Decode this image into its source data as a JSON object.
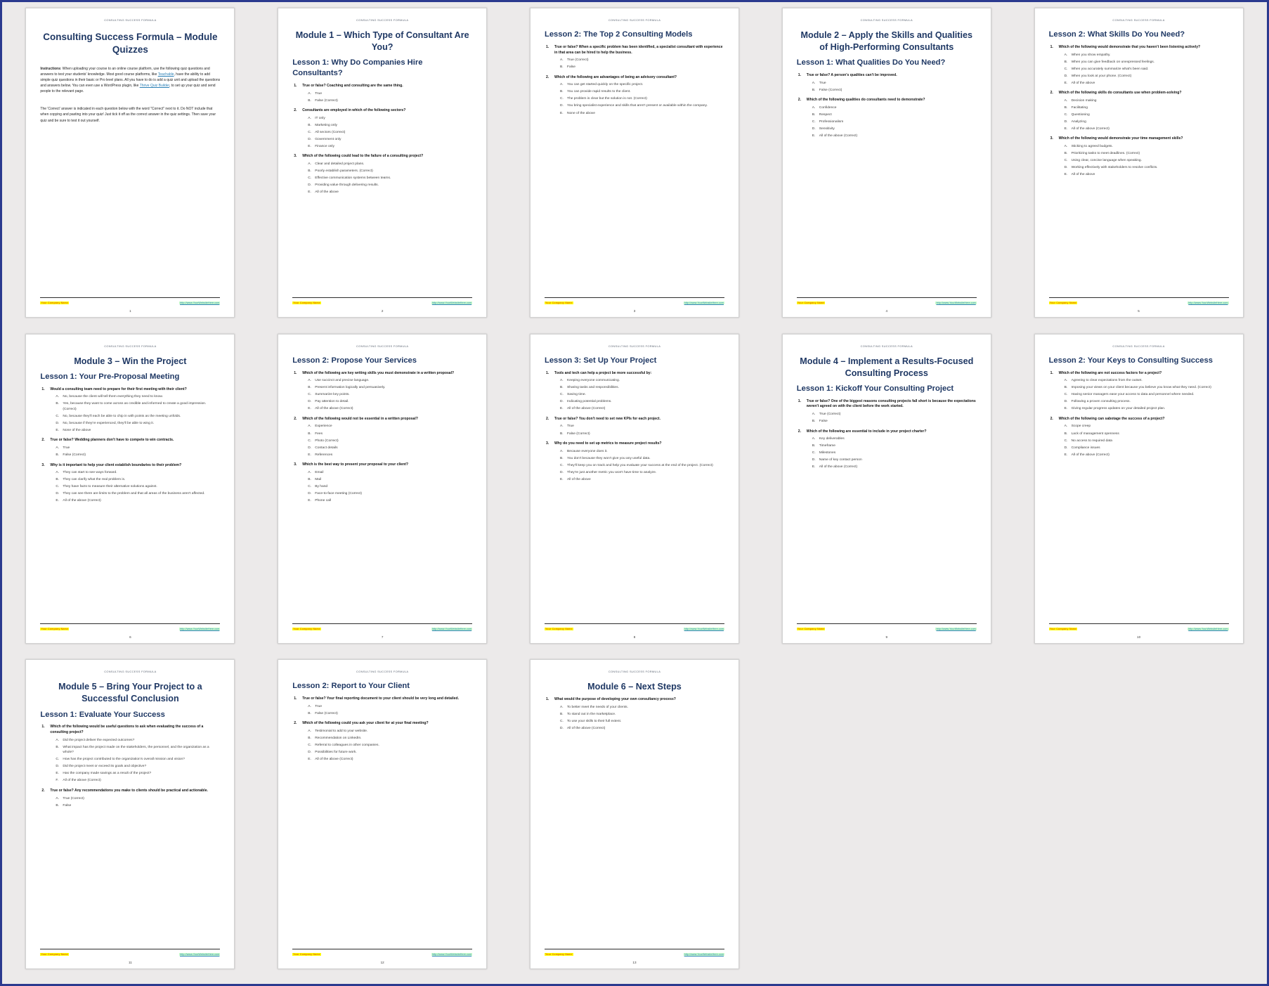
{
  "document": {
    "running_head": "CONSULTING SUCCESS FORMULA",
    "footer": {
      "company": "Your Company Name",
      "url": "http://www.YourWebsiteHere.com"
    }
  },
  "pages": [
    {
      "number": "1",
      "doc_title": "Consulting Success Formula – Module Quizzes",
      "instructions": [
        "When uploading your course to an online course platform, use the following quiz questions and answers to test your students' knowledge. Most good course platforms, like Teachable, have the ability to add simple quiz questions in their basic or Pro level plans. All you have to do is add a quiz unit and upload the questions and answers below. You can even use a WordPress plugin, like Thrive Quiz Builder, to set up your quiz and send people to the relevant page.",
        "The 'Correct' answer is indicated in each question below with the word \"Correct\" next to it. Do NOT include that when copying and pasting into your quiz! Just tick it off as the correct answer in the quiz settings. Then save your quiz and be sure to test it out yourself."
      ],
      "instructions_label": "Instructions",
      "links": [
        "Teachable",
        "Thrive Quiz Builder"
      ]
    },
    {
      "number": "2",
      "module_title": "Module 1 – Which Type of Consultant Are You?",
      "lesson_title": "Lesson 1: Why Do Companies Hire Consultants?",
      "questions": [
        {
          "q": "True or false? Coaching and consulting are the same thing.",
          "a": [
            "True",
            "False (Correct)"
          ]
        },
        {
          "q": "Consultants are employed in which of the following sectors?",
          "a": [
            "IT only",
            "Marketing only",
            "All sectors (Correct)",
            "Government only",
            "Finance only"
          ]
        },
        {
          "q": "Which of the following could lead to the failure of a consulting project?",
          "a": [
            "Clear and detailed project plans.",
            "Poorly establish parameters. (Correct)",
            "Effective communication systems between teams.",
            "Providing value through delivering results.",
            "All of the above"
          ]
        }
      ]
    },
    {
      "number": "3",
      "lesson_title": "Lesson 2: The Top 2 Consulting Models",
      "questions": [
        {
          "q": "True or false? When a specific problem has been identified, a specialist consultant with experience in that area can be hired to help the business.",
          "a": [
            "True (Correct)",
            "False"
          ]
        },
        {
          "q": "Which of the following are advantages of being an advisory consultant?",
          "a": [
            "You can get started quickly on the specific project.",
            "You can provide rapid results to the client.",
            "The problem is clear but the solution is not. (Correct)",
            "You bring specialist experience and skills that aren't present or available within the company.",
            "None of the above"
          ]
        }
      ]
    },
    {
      "number": "4",
      "module_title": "Module 2 – Apply the Skills and Qualities of High-Performing Consultants",
      "lesson_title": "Lesson 1: What Qualities Do You Need?",
      "questions": [
        {
          "q": "True or false? A person's qualities can't be improved.",
          "a": [
            "True",
            "False (Correct)"
          ]
        },
        {
          "q": "Which of the following qualities do consultants need to demonstrate?",
          "a": [
            "Confidence",
            "Respect",
            "Professionalism",
            "Sensitivity",
            "All of the above (Correct)"
          ]
        }
      ]
    },
    {
      "number": "5",
      "lesson_title": "Lesson 2: What Skills Do You Need?",
      "questions": [
        {
          "q": "Which of the following would demonstrate that you haven't been listening actively?",
          "a": [
            "When you show empathy.",
            "When you can give feedback on unexpressed feelings.",
            "When you accurately summarize what's been said.",
            "When you look at your phone. (Correct)",
            "All of the above"
          ]
        },
        {
          "q": "Which of the following skills do consultants use when problem-solving?",
          "a": [
            "Decision making",
            "Facilitating",
            "Questioning",
            "Analyzing",
            "All of the above (Correct)"
          ]
        },
        {
          "q": "Which of the following would demonstrate your time management skills?",
          "a": [
            "Sticking to agreed budgets.",
            "Prioritizing tasks to meet deadlines. (Correct)",
            "Using clear, concise language when speaking.",
            "Working effectively with stakeholders to resolve conflicts.",
            "All of the above"
          ]
        }
      ]
    },
    {
      "number": "6",
      "module_title": "Module 3 – Win the Project",
      "lesson_title": "Lesson 1: Your Pre-Proposal Meeting",
      "questions": [
        {
          "q": "Would a consulting team need to prepare for their first meeting with their client?",
          "a": [
            "No, because the client will tell them everything they need to know.",
            "Yes, because they want to come across as credible and informed to create a good impression. (Correct)",
            "No, because they'll each be able to chip in with points as the meeting unfolds.",
            "No, because if they're experienced, they'll be able to wing it.",
            "None of the above"
          ]
        },
        {
          "q": "True or false? Wedding planners don't have to compete to win contracts.",
          "a": [
            "True",
            "False (Correct)"
          ]
        },
        {
          "q": "Why is it important to help your client establish boundaries to their problem?",
          "a": [
            "They can start to see ways forward.",
            "They can clarify what the real problem is.",
            "They have facts to measure their alternative solutions against.",
            "They can see there are limits to the problem and that all areas of the business aren't affected.",
            "All of the above (Correct)"
          ]
        }
      ]
    },
    {
      "number": "7",
      "lesson_title": "Lesson 2: Propose Your Services",
      "questions": [
        {
          "q": "Which of the following are key writing skills you must demonstrate in a written proposal?",
          "a": [
            "Use succinct and precise language.",
            "Present information logically and persuasively.",
            "Summarize key points.",
            "Pay attention to detail.",
            "All of the above (Correct)"
          ]
        },
        {
          "q": "Which of the following would not be essential in a written proposal?",
          "a": [
            "Experience",
            "Fees",
            "Photo (Correct)",
            "Contact details",
            "References"
          ]
        },
        {
          "q": "Which is the best way to present your proposal to your client?",
          "a": [
            "Email",
            "Mail",
            "By hand",
            "Face-to-face meeting (Correct)",
            "Phone call"
          ]
        }
      ]
    },
    {
      "number": "8",
      "lesson_title": "Lesson 3: Set Up Your Project",
      "questions": [
        {
          "q": "Tools and tech can help a project be more successful by:",
          "a": [
            "Keeping everyone communicating.",
            "Sharing tasks and responsibilities.",
            "Saving time.",
            "Indicating potential problems.",
            "All of the above (Correct)"
          ]
        },
        {
          "q": "True or false? You don't need to set new KPIs for each project.",
          "a": [
            "True",
            "False (Correct)"
          ]
        },
        {
          "q": "Why do you need to set up metrics to measure project results?",
          "a": [
            "Because everyone does it.",
            "You don't because they won't give you any useful data.",
            "They'll keep you on track and help you evaluate your success at the end of the project. (Correct)",
            "They're just another metric you won't have time to analyze.",
            "All of the above"
          ]
        }
      ]
    },
    {
      "number": "9",
      "module_title": "Module 4 – Implement a Results-Focused Consulting Process",
      "lesson_title": "Lesson 1: Kickoff Your Consulting Project",
      "questions": [
        {
          "q": "True or false? One of the biggest reasons consulting projects fall short is because the expectations weren't agreed on with the client before the work started.",
          "a": [
            "True (Correct)",
            "False"
          ]
        },
        {
          "q": "Which of the following are essential to include in your project charter?",
          "a": [
            "Key deliverables",
            "Timeframe",
            "Milestones",
            "Name of key contact person",
            "All of the above (Correct)"
          ]
        }
      ]
    },
    {
      "number": "10",
      "lesson_title": "Lesson 2: Your Keys to Consulting Success",
      "questions": [
        {
          "q": "Which of the following are not success factors for a project?",
          "a": [
            "Agreeing to clear expectations from the outset.",
            "Imposing your views on your client because you believe you know what they need. (Correct)",
            "Having senior managers ease your access to data and personnel where needed.",
            "Following a proven consulting process.",
            "Giving regular progress updates on your detailed project plan."
          ]
        },
        {
          "q": "Which of the following can sabotage the success of a project?",
          "a": [
            "Scope creep",
            "Lack of management openness",
            "No access to required data",
            "Compliance issues",
            "All of the above (Correct)"
          ]
        }
      ]
    },
    {
      "number": "11",
      "module_title": "Module 5 – Bring Your Project to a Successful Conclusion",
      "lesson_title": "Lesson 1: Evaluate Your Success",
      "questions": [
        {
          "q": "Which of the following would be useful questions to ask when evaluating the success of a consulting project?",
          "a": [
            "Did the project deliver the expected outcomes?",
            "What impact has the project made on the stakeholders, the personnel, and the organization as a whole?",
            "How has the project contributed to the organization's overall mission and vision?",
            "Did the project meet or exceed its goals and objective?",
            "Has the company made savings as a result of the project?",
            "All of the above (Correct)"
          ]
        },
        {
          "q": "True or false? Any recommendations you make to clients should be practical and actionable.",
          "a": [
            "True (Correct)",
            "False"
          ]
        }
      ]
    },
    {
      "number": "12",
      "lesson_title": "Lesson 2: Report to Your Client",
      "questions": [
        {
          "q": "True or false? Your final reporting document to your client should be very long and detailed.",
          "a": [
            "True",
            "False (Correct)"
          ]
        },
        {
          "q": "Which of the following could you ask your client for at your final meeting?",
          "a": [
            "Testimonial to add to your website.",
            "Recommendation on LinkedIn.",
            "Referral to colleagues in other companies.",
            "Possibilities for future work.",
            "All of the above (Correct)"
          ]
        }
      ]
    },
    {
      "number": "13",
      "module_title": "Module 6 – Next Steps",
      "questions": [
        {
          "q": "What would the purpose of developing your own consultancy process?",
          "a": [
            "To better meet the needs of your clients.",
            "To stand out in the marketplace.",
            "To use your skills to their full extent.",
            "All of the above (Correct)"
          ]
        }
      ]
    }
  ]
}
